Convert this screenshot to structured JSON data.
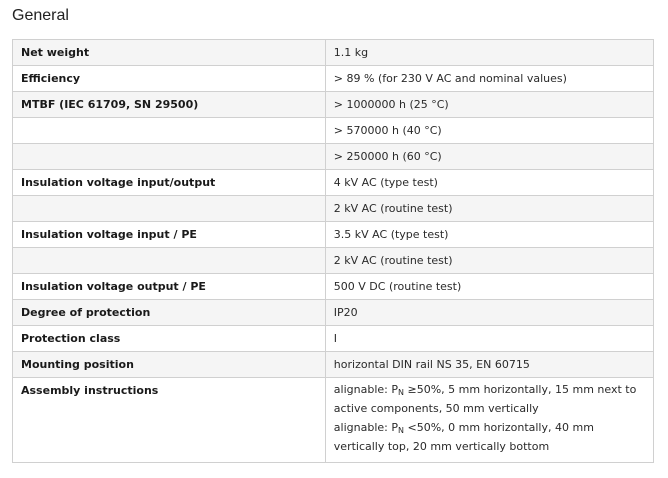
{
  "section": {
    "title": "General"
  },
  "rows": [
    {
      "label": "Net weight",
      "value": "1.1 kg"
    },
    {
      "label": "Efficiency",
      "value": "> 89 % (for 230 V AC and nominal values)"
    },
    {
      "label": "MTBF (IEC 61709, SN 29500)",
      "value": "> 1000000 h (25 °C)"
    },
    {
      "label": "",
      "value": "> 570000 h (40 °C)"
    },
    {
      "label": "",
      "value": "> 250000 h (60 °C)"
    },
    {
      "label": "Insulation voltage input/output",
      "value": "4 kV AC (type test)"
    },
    {
      "label": "",
      "value": "2 kV AC (routine test)"
    },
    {
      "label": "Insulation voltage input / PE",
      "value": "3.5 kV AC (type test)"
    },
    {
      "label": "",
      "value": "2 kV AC (routine test)"
    },
    {
      "label": "Insulation voltage output / PE",
      "value": "500 V DC (routine test)"
    },
    {
      "label": "Degree of protection",
      "value": "IP20"
    },
    {
      "label": "Protection class",
      "value": "I"
    },
    {
      "label": "Mounting position",
      "value": "horizontal DIN rail NS 35, EN 60715"
    }
  ],
  "assembly": {
    "label": "Assembly instructions",
    "line1": {
      "prefix": "alignable: P",
      "sub": "N",
      "text": " ≥50%, 5 mm horizontally, 15 mm next to active components, 50 mm vertically"
    },
    "line2": {
      "prefix": "alignable: P",
      "sub": "N",
      "text": " <50%, 0 mm horizontally, 40 mm vertically top, 20 mm vertically bottom"
    }
  }
}
